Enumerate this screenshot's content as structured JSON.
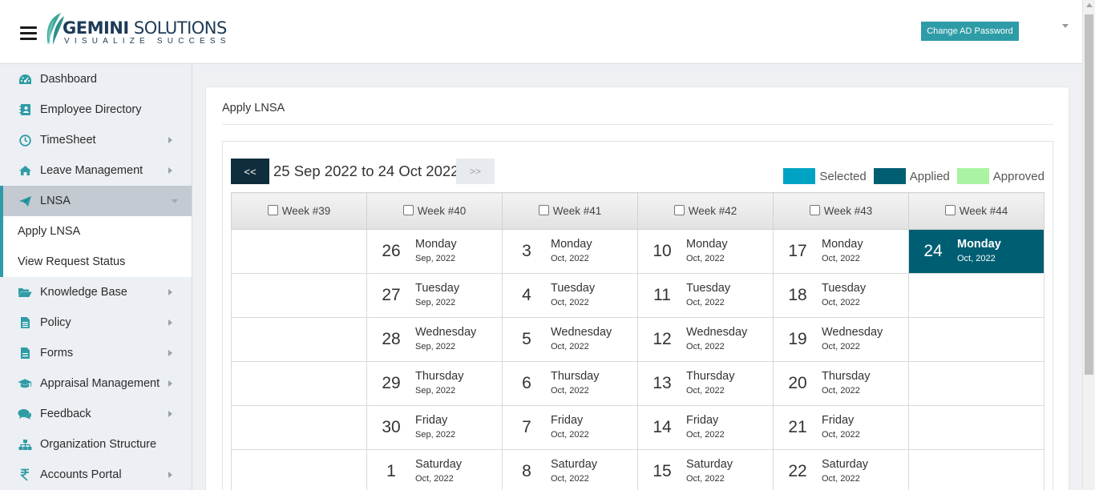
{
  "header": {
    "logo_main": "GEMINI",
    "logo_main_2": "SOLUTIONS",
    "logo_tagline": "VISUALIZE SUCCESS",
    "change_password_label": "Change AD Password"
  },
  "colors": {
    "accent": "#2e9ca6",
    "selected": "#00a3c4",
    "applied": "#005e73",
    "approved": "#a9f3a3",
    "prev_button": "#0f2d3d"
  },
  "sidebar": {
    "items": [
      {
        "label": "Dashboard",
        "icon": "dashboard-icon",
        "has_arrow": false
      },
      {
        "label": "Employee Directory",
        "icon": "address-book-icon",
        "has_arrow": false
      },
      {
        "label": "TimeSheet",
        "icon": "clock-icon",
        "has_arrow": true
      },
      {
        "label": "Leave Management",
        "icon": "home-icon",
        "has_arrow": true
      },
      {
        "label": "LNSA",
        "icon": "paper-plane-icon",
        "has_arrow": true,
        "expanded": true
      },
      {
        "label": "Knowledge Base",
        "icon": "folder-open-icon",
        "has_arrow": true
      },
      {
        "label": "Policy",
        "icon": "file-text-icon",
        "has_arrow": true
      },
      {
        "label": "Forms",
        "icon": "file-icon",
        "has_arrow": true
      },
      {
        "label": "Appraisal Management",
        "icon": "graduation-cap-icon",
        "has_arrow": true
      },
      {
        "label": "Feedback",
        "icon": "comments-icon",
        "has_arrow": true
      },
      {
        "label": "Organization Structure",
        "icon": "sitemap-icon",
        "has_arrow": false
      },
      {
        "label": "Accounts Portal",
        "icon": "rupee-icon",
        "has_arrow": true
      }
    ],
    "lnsa_sub": [
      {
        "label": "Apply LNSA"
      },
      {
        "label": "View Request Status"
      }
    ]
  },
  "main": {
    "title": "Apply LNSA",
    "prev_label": "<<",
    "next_label": ">>",
    "range": "25 Sep 2022 to 24 Oct 2022",
    "legend": [
      {
        "label": "Selected",
        "color": "#00a3c4"
      },
      {
        "label": "Applied",
        "color": "#005e73"
      },
      {
        "label": "Approved",
        "color": "#a9f3a3"
      }
    ],
    "weeks": [
      "Week #39",
      "Week #40",
      "Week #41",
      "Week #42",
      "Week #43",
      "Week #44"
    ],
    "rows": [
      [
        null,
        {
          "num": "26",
          "day": "Monday",
          "month": "Sep, 2022"
        },
        {
          "num": "3",
          "day": "Monday",
          "month": "Oct, 2022"
        },
        {
          "num": "10",
          "day": "Monday",
          "month": "Oct, 2022"
        },
        {
          "num": "17",
          "day": "Monday",
          "month": "Oct, 2022"
        },
        {
          "num": "24",
          "day": "Monday",
          "month": "Oct, 2022",
          "status": "applied"
        }
      ],
      [
        null,
        {
          "num": "27",
          "day": "Tuesday",
          "month": "Sep, 2022"
        },
        {
          "num": "4",
          "day": "Tuesday",
          "month": "Oct, 2022"
        },
        {
          "num": "11",
          "day": "Tuesday",
          "month": "Oct, 2022"
        },
        {
          "num": "18",
          "day": "Tuesday",
          "month": "Oct, 2022"
        },
        null
      ],
      [
        null,
        {
          "num": "28",
          "day": "Wednesday",
          "month": "Sep, 2022"
        },
        {
          "num": "5",
          "day": "Wednesday",
          "month": "Oct, 2022"
        },
        {
          "num": "12",
          "day": "Wednesday",
          "month": "Oct, 2022"
        },
        {
          "num": "19",
          "day": "Wednesday",
          "month": "Oct, 2022"
        },
        null
      ],
      [
        null,
        {
          "num": "29",
          "day": "Thursday",
          "month": "Sep, 2022"
        },
        {
          "num": "6",
          "day": "Thursday",
          "month": "Oct, 2022"
        },
        {
          "num": "13",
          "day": "Thursday",
          "month": "Oct, 2022"
        },
        {
          "num": "20",
          "day": "Thursday",
          "month": "Oct, 2022"
        },
        null
      ],
      [
        null,
        {
          "num": "30",
          "day": "Friday",
          "month": "Sep, 2022"
        },
        {
          "num": "7",
          "day": "Friday",
          "month": "Oct, 2022"
        },
        {
          "num": "14",
          "day": "Friday",
          "month": "Oct, 2022"
        },
        {
          "num": "21",
          "day": "Friday",
          "month": "Oct, 2022"
        },
        null
      ],
      [
        null,
        {
          "num": "1",
          "day": "Saturday",
          "month": "Oct, 2022"
        },
        {
          "num": "8",
          "day": "Saturday",
          "month": "Oct, 2022"
        },
        {
          "num": "15",
          "day": "Saturday",
          "month": "Oct, 2022"
        },
        {
          "num": "22",
          "day": "Saturday",
          "month": "Oct, 2022"
        },
        null
      ]
    ]
  }
}
